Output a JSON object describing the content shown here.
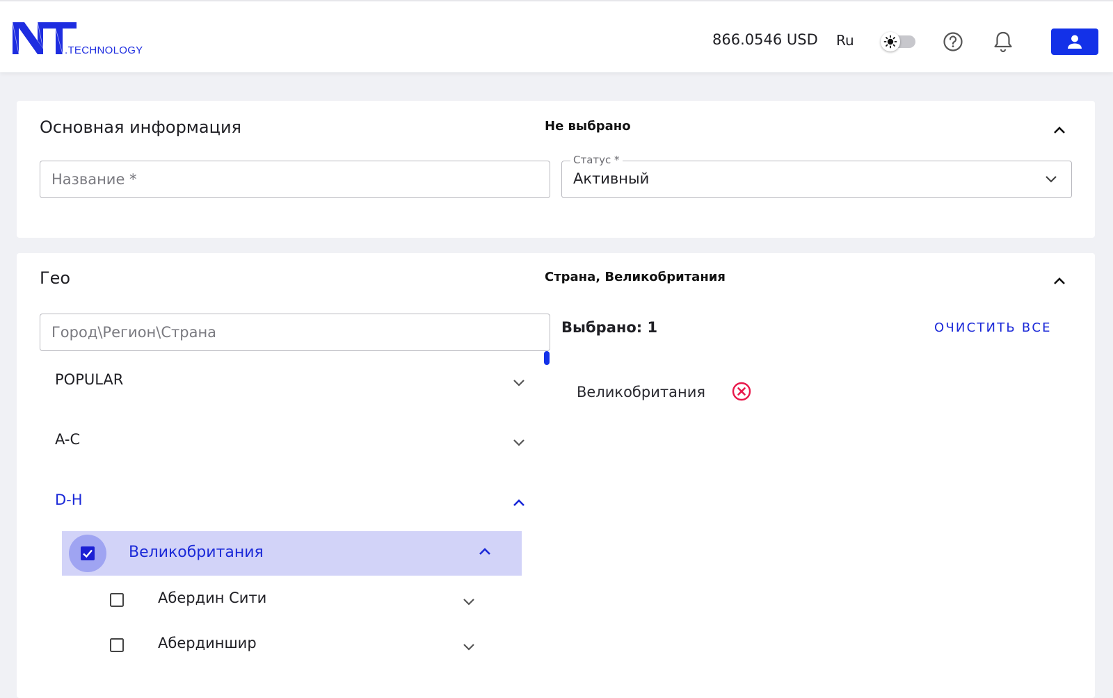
{
  "header": {
    "logo_text": "NT",
    "logo_suffix": ".TECHNOLOGY",
    "balance": "866.0546 USD",
    "language": "Ru",
    "theme_toggle_icon": "sun-icon",
    "help_icon": "help-circle-icon",
    "notifications_icon": "bell-icon",
    "profile_icon": "user-icon",
    "brand_color": "#1331e8"
  },
  "basic_info": {
    "title": "Основная информация",
    "summary": "Не выбрано",
    "name_placeholder": "Название *",
    "status_label": "Статус *",
    "status_value": "Активный"
  },
  "geo": {
    "title": "Гео",
    "summary": "Страна, Великобритания",
    "search_placeholder": "Город\\Регион\\Страна",
    "groups": [
      {
        "label": "POPULAR",
        "expanded": false
      },
      {
        "label": "A-C",
        "expanded": false
      },
      {
        "label": "D-H",
        "expanded": true
      }
    ],
    "selected_country": {
      "label": "Великобритания",
      "checked": true,
      "expanded": true
    },
    "sub_items": [
      {
        "label": "Абердин Сити",
        "checked": false
      },
      {
        "label": "Абердиншир",
        "checked": false
      }
    ],
    "selected_count_text": "Выбрано: 1",
    "clear_all_label": "ОЧИСТИТЬ ВСЕ",
    "chips": [
      {
        "label": "Великобритания"
      }
    ],
    "accent_color": "#1b29d8",
    "remove_color": "#e8174a"
  }
}
